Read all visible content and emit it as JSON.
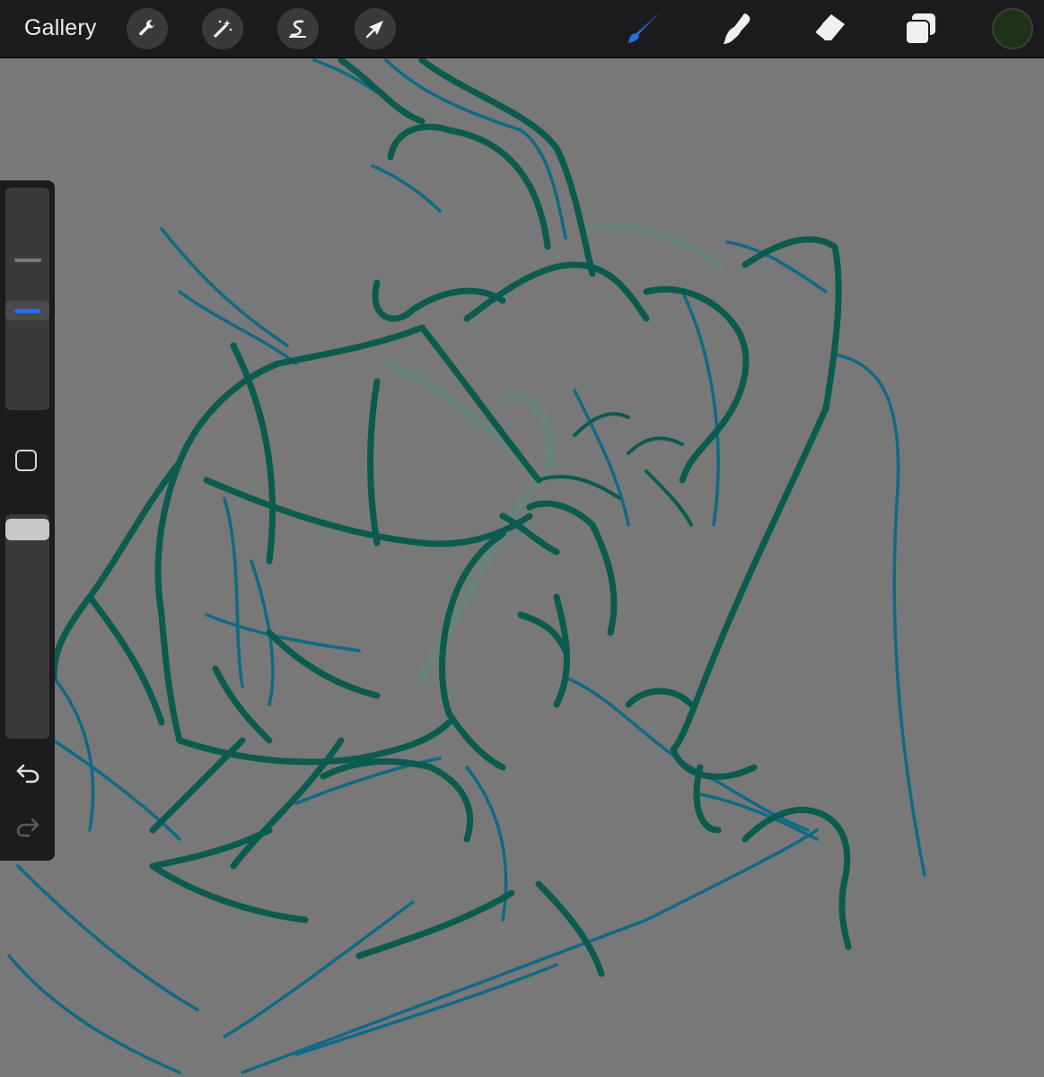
{
  "toolbar": {
    "gallery_label": "Gallery",
    "left_tools": [
      {
        "name": "actions",
        "icon": "wrench-icon"
      },
      {
        "name": "adjustments",
        "icon": "magic-wand-icon"
      },
      {
        "name": "selection",
        "icon": "selection-s-icon"
      },
      {
        "name": "transform",
        "icon": "arrow-cursor-icon"
      }
    ],
    "right_tools": [
      {
        "name": "brush",
        "icon": "brush-icon",
        "active": true
      },
      {
        "name": "smudge",
        "icon": "smudge-icon",
        "active": false
      },
      {
        "name": "eraser",
        "icon": "eraser-icon",
        "active": false
      },
      {
        "name": "layers",
        "icon": "layers-icon",
        "active": false
      }
    ],
    "active_color": "#1f3319",
    "accent_color": "#1f73e8"
  },
  "sidebar": {
    "brush_size_icon": "size-slider-icon",
    "modify_icon": "square-icon",
    "undo_icon": "undo-arrow-icon",
    "redo_icon": "redo-arrow-icon"
  },
  "canvas": {
    "background_color": "#787878",
    "stroke_colors": [
      "#0b5b4e",
      "#0f6a86",
      "#5a8f80"
    ]
  }
}
